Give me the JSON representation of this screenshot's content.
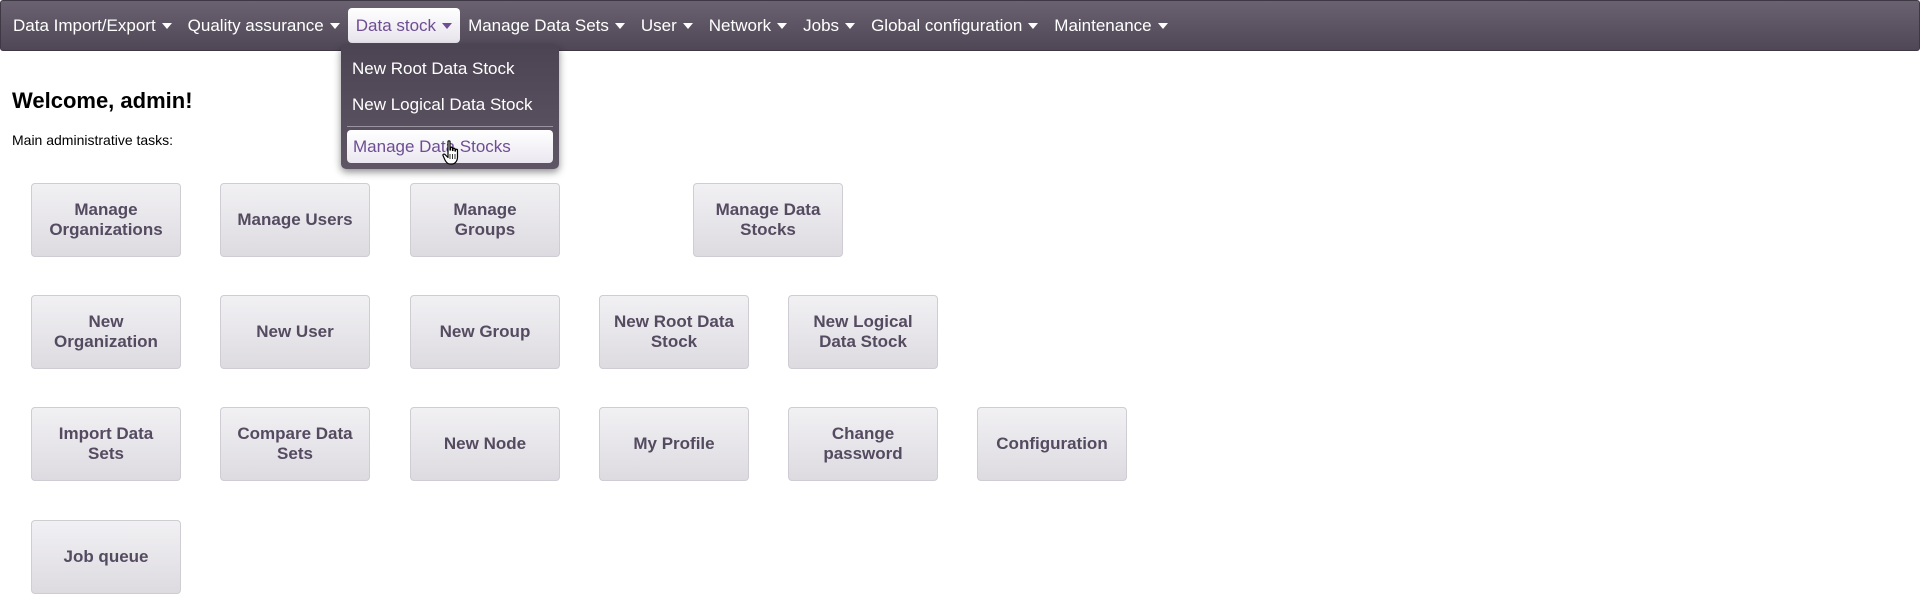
{
  "nav": {
    "items": [
      {
        "label": "Data Import/Export"
      },
      {
        "label": "Quality assurance"
      },
      {
        "label": "Data stock"
      },
      {
        "label": "Manage Data Sets"
      },
      {
        "label": "User"
      },
      {
        "label": "Network"
      },
      {
        "label": "Jobs"
      },
      {
        "label": "Global configuration"
      },
      {
        "label": "Maintenance"
      }
    ],
    "active_index": 2
  },
  "dropdown": {
    "items": [
      {
        "label": "New Root Data Stock"
      },
      {
        "label": "New Logical Data Stock"
      },
      {
        "label": "Manage Data Stocks"
      }
    ]
  },
  "main": {
    "welcome": "Welcome, admin!",
    "subtitle": "Main administrative tasks:",
    "buttons": [
      {
        "label": "Manage Organizations"
      },
      {
        "label": "Manage Users"
      },
      {
        "label": "Manage Groups"
      },
      {
        "label": "Manage Data Stocks"
      },
      {
        "label": "New Organization"
      },
      {
        "label": "New User"
      },
      {
        "label": "New Group"
      },
      {
        "label": "New Root Data Stock"
      },
      {
        "label": "New Logical Data Stock"
      },
      {
        "label": "Import Data Sets"
      },
      {
        "label": "Compare Data Sets"
      },
      {
        "label": "New Node"
      },
      {
        "label": "My Profile"
      },
      {
        "label": "Change password"
      },
      {
        "label": "Configuration"
      },
      {
        "label": "Job queue"
      }
    ]
  },
  "colors": {
    "nav_bg": "#5a5260",
    "accent": "#6d4e93",
    "button_text": "#554b61"
  },
  "icons": {
    "cursor": "hand-pointer-icon",
    "caret": "caret-down-icon"
  }
}
